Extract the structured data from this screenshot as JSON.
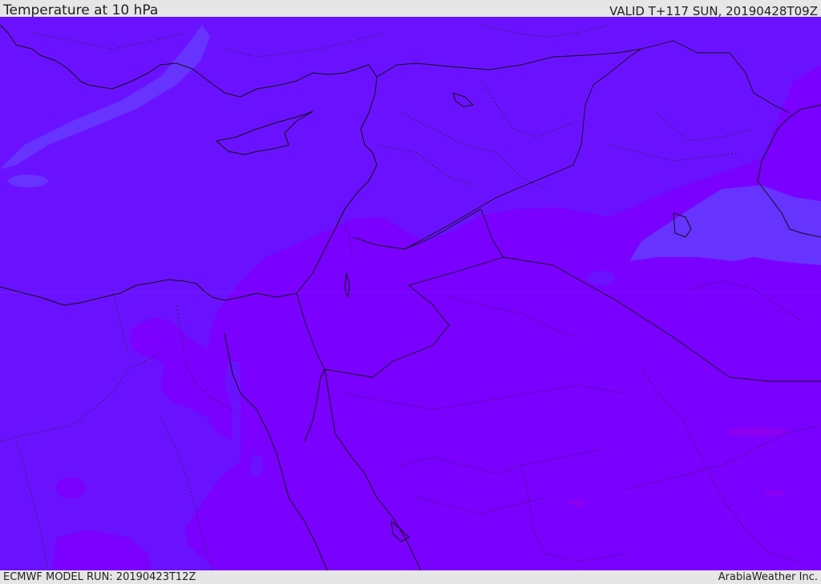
{
  "header": {
    "title": "Temperature at 10 hPa",
    "valid": "VALID T+117 SUN, 20190428T09Z"
  },
  "footer": {
    "model_run": "ECMWF MODEL RUN: 20190423T12Z",
    "credit": "ArabiaWeather Inc."
  },
  "map": {
    "colors": {
      "background": "#7a00ff",
      "colder_band": "#6a12ff",
      "coldest_band": "#6633ff",
      "warm_spots": "#8a00f0",
      "lines": "#111111"
    }
  }
}
